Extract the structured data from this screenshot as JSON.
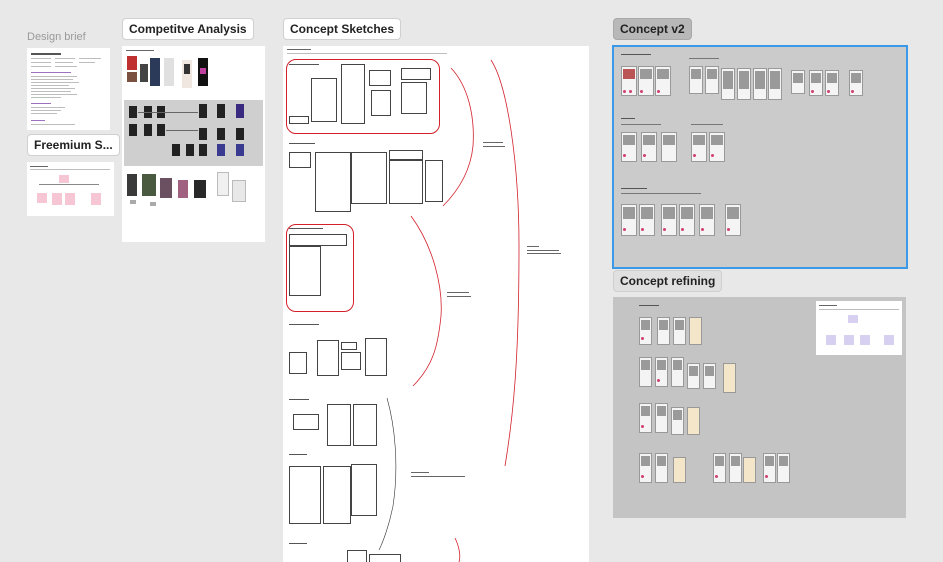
{
  "sections": {
    "design_brief": "Design brief",
    "competitive_analysis": "Competitve Analysis",
    "concept_sketches": "Concept Sketches",
    "concept_v2": "Concept v2",
    "freemium": "Freemium S...",
    "concept_refining": "Concept refining"
  },
  "colors": {
    "canvas_bg": "#e8e8e8",
    "selection": "#3a9ae8",
    "sketch_highlight": "#d3202a",
    "sticky_pink": "#f7c6d5"
  }
}
